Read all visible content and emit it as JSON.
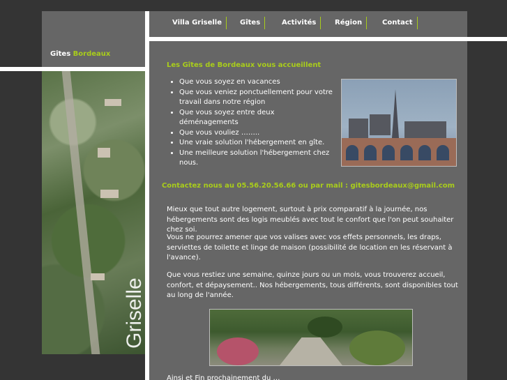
{
  "brand": {
    "part1": "Gîtes",
    "part2": "Bordeaux"
  },
  "nav": {
    "items": [
      {
        "label": "Villa Griselle"
      },
      {
        "label": "Gîtes"
      },
      {
        "label": "Activités"
      },
      {
        "label": "Région"
      },
      {
        "label": "Contact"
      }
    ]
  },
  "sidebar": {
    "watermark": "Griselle"
  },
  "main": {
    "title": "Les Gîtes de Bordeaux vous accueillent",
    "bullets": [
      "Que vous soyez en vacances",
      "Que vous veniez ponctuellement pour votre travail dans notre région",
      "Que vous soyez entre deux déménagements",
      "Que vous vouliez ……..",
      "Une vraie solution l'hébergement en gîte.",
      "Une meilleure solution l'hébergement chez nous."
    ],
    "contact": "Contactez nous au 05.56.20.56.66 ou par mail : gitesbordeaux@gmail.com",
    "para1": "Mieux que tout autre logement, surtout à prix comparatif à la journée, nos hébergements sont des logis meublés avec tout le confort que l'on peut souhaiter chez soi.",
    "para2": "Vous ne pourrez amener que vos valises avec vos effets personnels, les draps, serviettes de toilette et linge de maison (possibilité de location en les réservant à l'avance).",
    "para3": "Que vous restiez une semaine, quinze jours ou un mois, vous trouverez accueil, confort, et dépaysement.. Nos hébergements, tous différents, sont disponibles tout au long de l'année.",
    "bottom": "Ainsi et Fin prochainement du …"
  },
  "colors": {
    "accent": "#a9cd1b",
    "panel": "#666666",
    "background": "#343434"
  },
  "images": {
    "bridge": "bordeaux-bridge-photo",
    "garden": "garden-photo",
    "aerial": "aerial-map-photo"
  }
}
